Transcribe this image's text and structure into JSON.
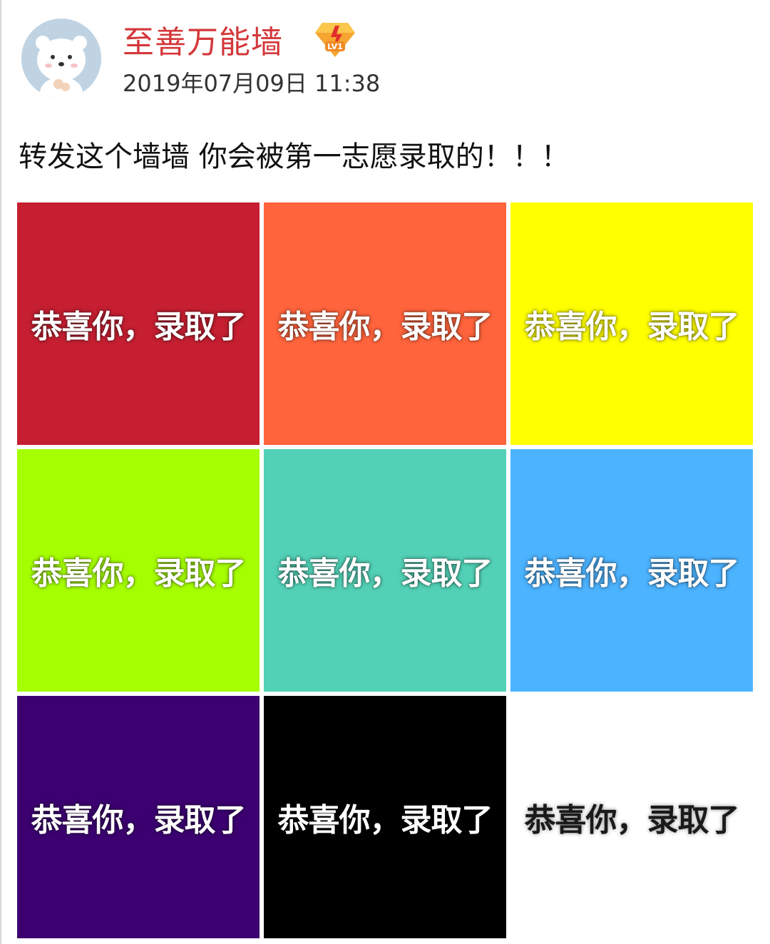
{
  "post": {
    "username": "至善万能墙",
    "badge_icon": "level-badge-icon",
    "badge_text": "LV1",
    "timestamp": "2019年07月09日 11:38",
    "text": "转发这个墙墙 你会被第一志愿录取的！！！"
  },
  "colors": {
    "username": "#d4373a"
  },
  "grid": {
    "tiles": [
      {
        "caption": "恭喜你，录取了",
        "color": "#c51f31",
        "caption_style": "light"
      },
      {
        "caption": "恭喜你，录取了",
        "color": "#ff643c",
        "caption_style": "light"
      },
      {
        "caption": "恭喜你，录取了",
        "color": "#ffff00",
        "caption_style": "light"
      },
      {
        "caption": "恭喜你，录取了",
        "color": "#a6ff00",
        "caption_style": "light"
      },
      {
        "caption": "恭喜你，录取了",
        "color": "#52d1b6",
        "caption_style": "light"
      },
      {
        "caption": "恭喜你，录取了",
        "color": "#4cb3ff",
        "caption_style": "light"
      },
      {
        "caption": "恭喜你，录取了",
        "color": "#3c0070",
        "caption_style": "light"
      },
      {
        "caption": "恭喜你，录取了",
        "color": "#000000",
        "caption_style": "light"
      },
      {
        "caption": "恭喜你，录取了",
        "color": "#ffffff",
        "caption_style": "dark"
      }
    ]
  }
}
